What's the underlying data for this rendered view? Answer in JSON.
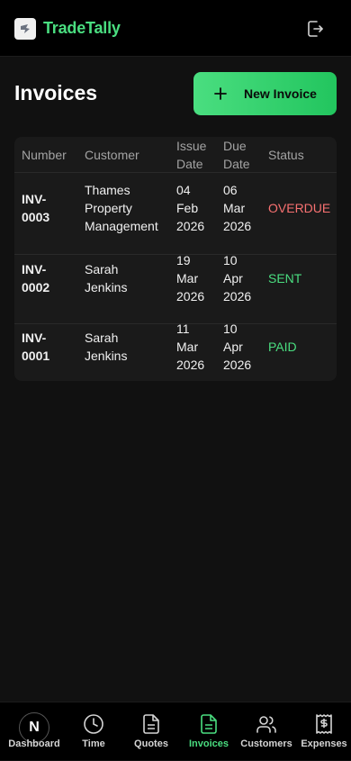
{
  "app": {
    "brand": "TradeTally"
  },
  "page": {
    "title": "Invoices",
    "new_button_label": "New Invoice"
  },
  "table": {
    "headers": {
      "number": "Number",
      "customer": "Customer",
      "issue_date": "Issue\nDate",
      "due_date": "Due\nDate",
      "status": "Status"
    },
    "rows": [
      {
        "number": "INV-\n0003",
        "customer": "Thames\nProperty\nManagement",
        "issue_date": "04\nFeb\n2026",
        "due_date": "06\nMar\n2026",
        "status": "OVERDUE"
      },
      {
        "number": "INV-\n0002",
        "customer": "Sarah\nJenkins",
        "issue_date": "19\nMar\n2026",
        "due_date": "10\nApr\n2026",
        "status": "SENT"
      },
      {
        "number": "INV-\n0001",
        "customer": "Sarah\nJenkins",
        "issue_date": "11\nMar\n2026",
        "due_date": "10\nApr\n2026",
        "status": "PAID"
      }
    ]
  },
  "nav": {
    "avatar_letter": "N",
    "items": [
      {
        "label": "Dashboard",
        "icon": "dashboard-icon"
      },
      {
        "label": "Time",
        "icon": "clock-icon"
      },
      {
        "label": "Quotes",
        "icon": "document-icon"
      },
      {
        "label": "Invoices",
        "icon": "invoice-icon",
        "active": true
      },
      {
        "label": "Customers",
        "icon": "users-icon"
      },
      {
        "label": "Expenses",
        "icon": "receipt-icon"
      }
    ]
  },
  "colors": {
    "accent": "#4ade80",
    "overdue": "#f87171",
    "background": "#111111",
    "card": "#1a1a1a"
  }
}
